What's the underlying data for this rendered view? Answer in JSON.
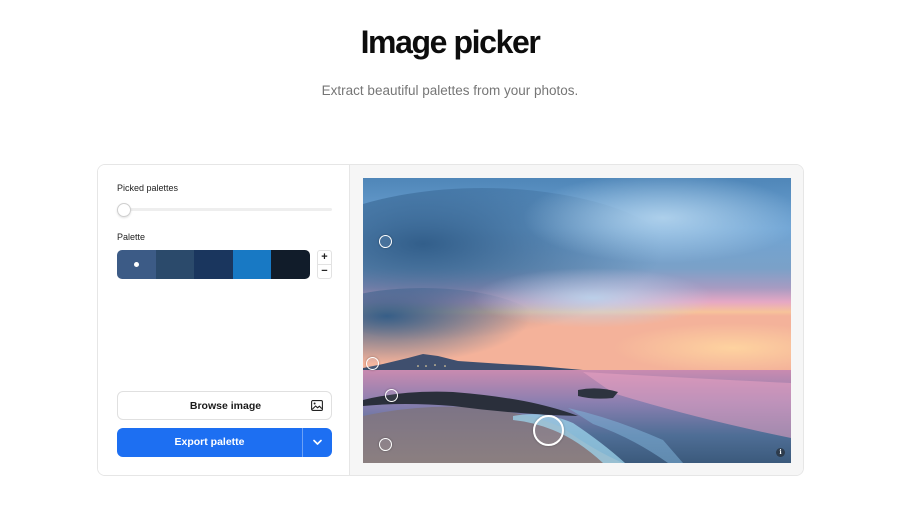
{
  "header": {
    "title": "Image picker",
    "subtitle": "Extract beautiful palettes from your photos."
  },
  "controls": {
    "picked_palettes_label": "Picked palettes",
    "palette_label": "Palette",
    "stepper_plus": "+",
    "stepper_minus": "−",
    "slider_value": 0
  },
  "palette": {
    "swatches": [
      "#3c5b86",
      "#2b4a6b",
      "#1a365e",
      "#1879c4",
      "#111c2a"
    ],
    "selected_index": 0
  },
  "buttons": {
    "browse_label": "Browse image",
    "browse_icon": "image-icon",
    "export_label": "Export palette",
    "export_dropdown_icon": "chevron-down-icon"
  },
  "colors": {
    "accent": "#1d6ff2"
  },
  "photo": {
    "info_glyph": "i",
    "info_icon": "info-icon"
  }
}
